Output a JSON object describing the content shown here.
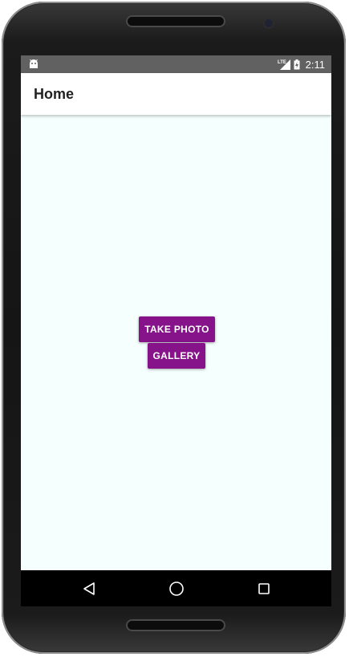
{
  "status_bar": {
    "time": "2:11",
    "network": "LTE",
    "icons": [
      "android-notification-icon",
      "lte-signal-icon",
      "battery-charging-icon"
    ]
  },
  "app_bar": {
    "title": "Home"
  },
  "main": {
    "buttons": [
      {
        "label": "TAKE PHOTO"
      },
      {
        "label": "GALLERY"
      }
    ]
  },
  "nav_bar": {
    "icons": [
      "back-icon",
      "home-icon",
      "recents-icon"
    ]
  },
  "colors": {
    "button_bg": "#86138a",
    "content_bg": "#f5fffe",
    "status_bar_bg": "#616161",
    "app_bar_bg": "#ffffff"
  }
}
